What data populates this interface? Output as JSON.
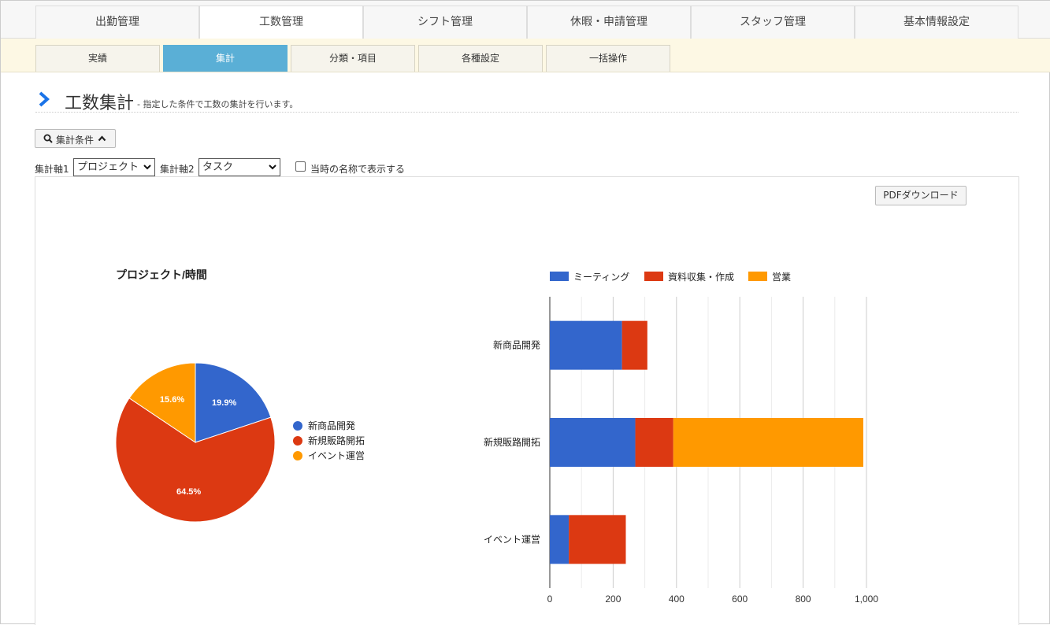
{
  "main_nav": {
    "tabs": [
      {
        "label": "出勤管理",
        "active": false
      },
      {
        "label": "工数管理",
        "active": true
      },
      {
        "label": "シフト管理",
        "active": false
      },
      {
        "label": "休暇・申請管理",
        "active": false
      },
      {
        "label": "スタッフ管理",
        "active": false
      },
      {
        "label": "基本情報設定",
        "active": false
      }
    ]
  },
  "sub_nav": {
    "tabs": [
      {
        "label": "実績",
        "active": false
      },
      {
        "label": "集計",
        "active": true
      },
      {
        "label": "分類・項目",
        "active": false
      },
      {
        "label": "各種設定",
        "active": false
      },
      {
        "label": "一括操作",
        "active": false
      }
    ]
  },
  "page": {
    "title": "工数集計",
    "description": "- 指定した条件で工数の集計を行います。"
  },
  "conditions": {
    "toggle_label": "集計条件",
    "axis1_label": "集計軸1",
    "axis1_value": "プロジェクト",
    "axis2_label": "集計軸2",
    "axis2_value": "タスク",
    "checkbox_label": "当時の名称で表示する",
    "checkbox_checked": false
  },
  "panel": {
    "pdf_button": "PDFダウンロード"
  },
  "colors": {
    "blue": "#3366cc",
    "red": "#dc3912",
    "orange": "#ff9900",
    "accent": "#5aafd6",
    "chevron": "#1a73e8"
  },
  "chart_data": [
    {
      "type": "pie",
      "title": "プロジェクト/時間",
      "categories": [
        "新商品開発",
        "新規販路開拓",
        "イベント運営"
      ],
      "values": [
        19.9,
        64.5,
        15.6
      ],
      "labels": [
        "19.9%",
        "64.5%",
        "15.6%"
      ],
      "colors": [
        "#3366cc",
        "#dc3912",
        "#ff9900"
      ],
      "legend": "right"
    },
    {
      "type": "bar",
      "orientation": "horizontal",
      "stacked": true,
      "categories": [
        "新商品開発",
        "新規販路開拓",
        "イベント運営"
      ],
      "series": [
        {
          "name": "ミーティング",
          "color": "#3366cc",
          "values": [
            228,
            270,
            60
          ]
        },
        {
          "name": "資料収集・作成",
          "color": "#dc3912",
          "values": [
            80,
            120,
            180
          ]
        },
        {
          "name": "営業",
          "color": "#ff9900",
          "values": [
            0,
            600,
            0
          ]
        }
      ],
      "xlim": [
        0,
        1000
      ],
      "xticks": [
        0,
        200,
        400,
        600,
        800,
        1000
      ],
      "xtick_labels": [
        "0",
        "200",
        "400",
        "600",
        "800",
        "1,000"
      ],
      "grid": true,
      "legend": "top"
    }
  ]
}
